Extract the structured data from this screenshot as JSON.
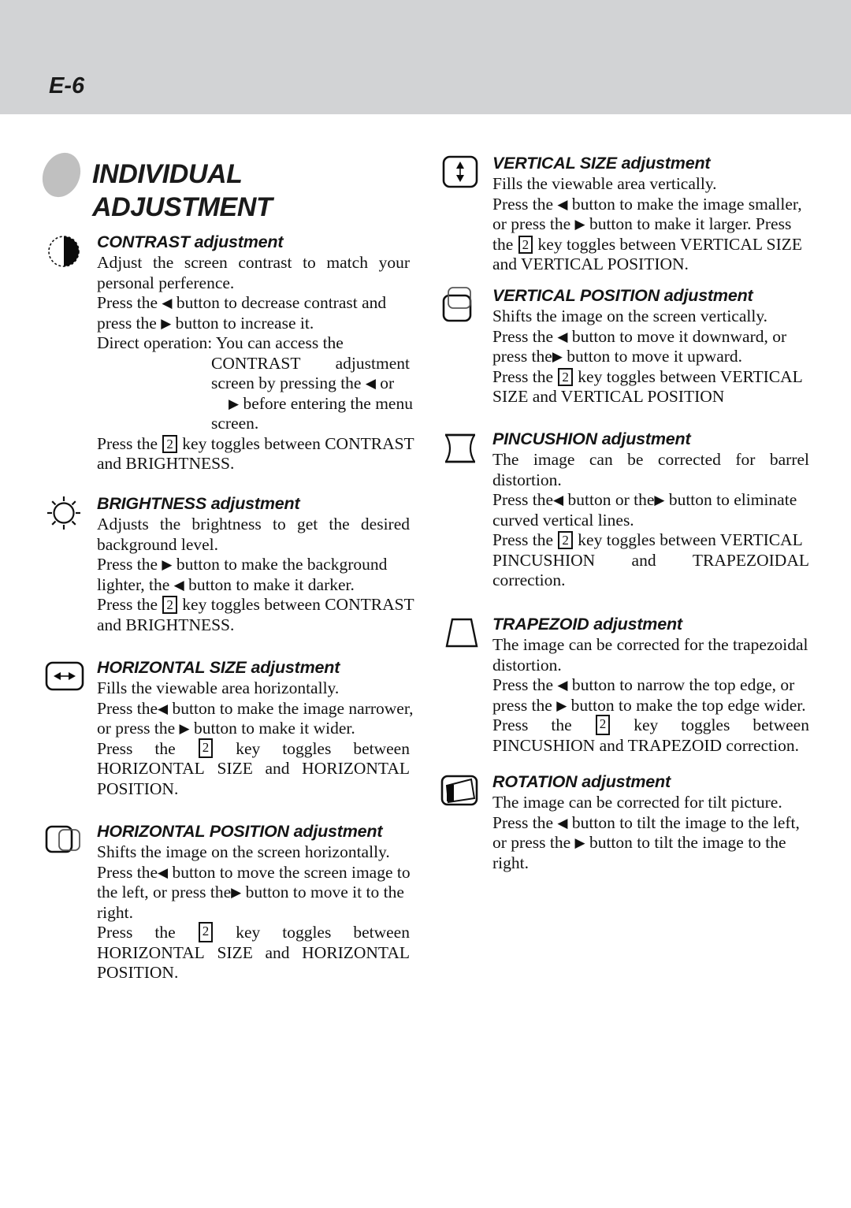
{
  "header": {
    "page_label": "E-6"
  },
  "title": {
    "line1": "INDIVIDUAL",
    "line2": "ADJUSTMENT"
  },
  "sections": {
    "contrast": {
      "icon": "contrast-half-circle-icon",
      "heading": "CONTRAST adjustment",
      "l1": "Adjust the screen contrast to match your",
      "l2": "personal perference.",
      "l3a": "Press the ",
      "l3b": " button to decrease contrast and",
      "l4a": "press the ",
      "l4b": " button to increase it.",
      "l5": "Direct operation: You can access the",
      "l6": "CONTRAST adjustment",
      "l7a": "screen by pressing the ",
      "l7b": " or",
      "l8a": " before entering the menu",
      "l9": "screen.",
      "l10a": "Press the ",
      "l10b": "2",
      "l10c": " key toggles between CONTRAST",
      "l11": "and BRIGHTNESS."
    },
    "brightness": {
      "icon": "sun-icon",
      "heading": "BRIGHTNESS adjustment",
      "l1": "Adjusts the brightness to get the desired",
      "l2": "background level.",
      "l3a": "Press the ",
      "l3b": " button to make the background",
      "l4a": "lighter, the ",
      "l4b": " button to make it darker.",
      "l5a": "Press the ",
      "l5b": "2",
      "l5c": " key toggles between CONTRAST",
      "l6": "and BRIGHTNESS."
    },
    "horizontal_size": {
      "icon": "horizontal-size-icon",
      "heading": "HORIZONTAL SIZE adjustment",
      "l1": "Fills the viewable area horizontally.",
      "l2a": "Press the",
      "l2b": " button to make the image narrower,",
      "l3a": "or press the ",
      "l3b": " button to make it wider.",
      "l4w1": "Press",
      "l4w2": "the",
      "l4key": "2",
      "l4w3": "key",
      "l4w4": "toggles",
      "l4w5": "between",
      "l5w1": "HORIZONTAL",
      "l5w2": "SIZE",
      "l5w3": "and",
      "l5w4": "HORIZONTAL",
      "l6": "POSITION."
    },
    "horizontal_position": {
      "icon": "horizontal-position-icon",
      "heading": "HORIZONTAL POSITION adjustment",
      "l1": "Shifts the image on the screen horizontally.",
      "l2a": "Press the",
      "l2b": " button to move the screen image to",
      "l3a": "the left, or press the",
      "l3b": " button to move it to the",
      "l4": "right.",
      "l5w1": "Press",
      "l5w2": "the",
      "l5key": "2",
      "l5w3": "key",
      "l5w4": "toggles",
      "l5w5": "between",
      "l6w1": "HORIZONTAL",
      "l6w2": "SIZE",
      "l6w3": "and",
      "l6w4": "HORIZONTAL",
      "l7": "POSITION."
    },
    "vertical_size": {
      "icon": "vertical-size-icon",
      "heading": "VERTICAL SIZE adjustment",
      "l1": "Fills the viewable area vertically.",
      "l2a": "Press the ",
      "l2b": " button to make the image smaller,",
      "l3a": "or press the ",
      "l3b": " button to make it larger. Press",
      "l4a": "the ",
      "l4b": "2",
      "l4c": " key toggles between VERTICAL SIZE",
      "l5": "and VERTICAL POSITION."
    },
    "vertical_position": {
      "icon": "vertical-position-icon",
      "heading": "VERTICAL POSITION adjustment",
      "l1": "Shifts the image on the screen vertically.",
      "l2a": "Press the ",
      "l2b": " button to move it downward, or",
      "l3a": "press the",
      "l3b": " button to move it upward.",
      "l4a": "Press the ",
      "l4b": "2",
      "l4c": " key toggles between VERTICAL",
      "l5": "SIZE and VERTICAL POSITION"
    },
    "pincushion": {
      "icon": "pincushion-icon",
      "heading": "PINCUSHION adjustment",
      "l1": "The image can be corrected for barrel",
      "l2": "distortion.",
      "l3a": "Press the",
      "l3b": " button or the",
      "l3c": " button to eliminate",
      "l4": "curved vertical lines.",
      "l5a": "Press the ",
      "l5b": "2",
      "l5c": " key toggles between VERTICAL",
      "l6w1": "PINCUSHION",
      "l6w2": "and",
      "l6w3": "TRAPEZOIDAL",
      "l7": "correction."
    },
    "trapezoid": {
      "icon": "trapezoid-icon",
      "heading": "TRAPEZOID adjustment",
      "l1": "The image can be corrected for the trapezoidal",
      "l2": "distortion.",
      "l3a": "Press the ",
      "l3b": " button to narrow the top edge, or",
      "l4a": "press the ",
      "l4b": " button to make the top edge wider.",
      "l5w1": "Press",
      "l5w2": "the",
      "l5key": "2",
      "l5w3": "key",
      "l5w4": "toggles",
      "l5w5": "between",
      "l6": "PINCUSHION and TRAPEZOID correction."
    },
    "rotation": {
      "icon": "rotation-icon",
      "heading": "ROTATION adjustment",
      "l1": "The image can be corrected for tilt picture.",
      "l2a": "Press the ",
      "l2b": " button to tilt the image to the left,",
      "l3a": "or press the ",
      "l3b": " button to tilt the image to the",
      "l4": "right."
    }
  },
  "glyphs": {
    "left_arrow": "◀",
    "right_arrow": "▶"
  },
  "colors": {
    "header_band": "#d2d3d5",
    "title_oval": "#c0c0c0",
    "text": "#121212"
  }
}
